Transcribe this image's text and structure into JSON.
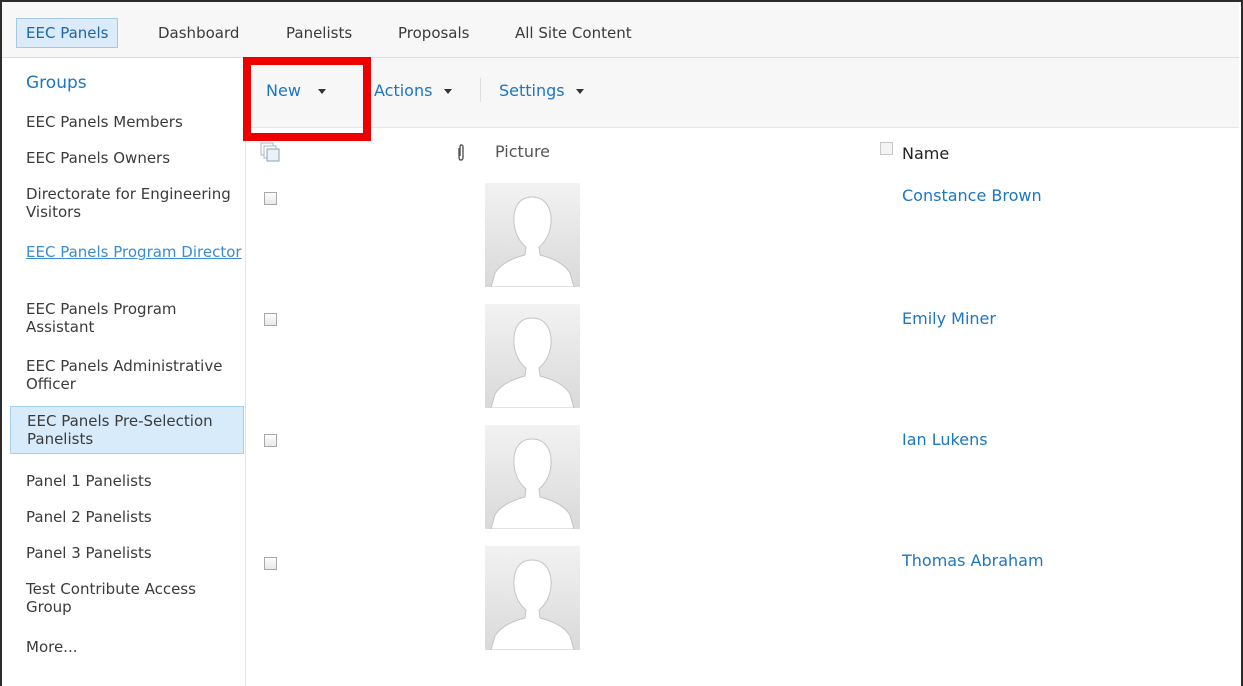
{
  "topnav": {
    "items": [
      {
        "label": "EEC Panels",
        "selected": true
      },
      {
        "label": "Dashboard"
      },
      {
        "label": "Panelists"
      },
      {
        "label": "Proposals"
      },
      {
        "label": "All Site Content"
      }
    ]
  },
  "leftnav": {
    "header": "Groups",
    "items": [
      {
        "label": "EEC Panels Members"
      },
      {
        "label": "EEC Panels Owners"
      },
      {
        "label": "Directorate for Engineering Visitors"
      },
      {
        "label": "EEC Panels Program Director",
        "link": true
      },
      {
        "label": "EEC Panels Program Assistant"
      },
      {
        "label": "EEC Panels Administrative Officer"
      },
      {
        "label": "EEC Panels Pre-Selection Panelists",
        "selected": true
      },
      {
        "label": "Panel 1 Panelists"
      },
      {
        "label": "Panel 2 Panelists"
      },
      {
        "label": "Panel 3 Panelists"
      },
      {
        "label": "Test Contribute Access Group"
      },
      {
        "label": "More..."
      }
    ]
  },
  "toolbar": {
    "new_label": "New",
    "actions_label": "Actions",
    "settings_label": "Settings"
  },
  "list": {
    "columns": {
      "picture": "Picture",
      "name": "Name"
    },
    "rows": [
      {
        "name": "Constance Brown"
      },
      {
        "name": "Emily Miner"
      },
      {
        "name": "Ian Lukens"
      },
      {
        "name": "Thomas Abraham"
      }
    ]
  },
  "colors": {
    "accent": "#1b76c4",
    "highlight": "#ee0000",
    "selected_bg": "#d8ebfa"
  },
  "icons": {
    "select_all": "select-all-icon",
    "attachment": "paperclip-icon",
    "avatar": "person-silhouette-icon",
    "dropdown": "caret-down-icon"
  }
}
